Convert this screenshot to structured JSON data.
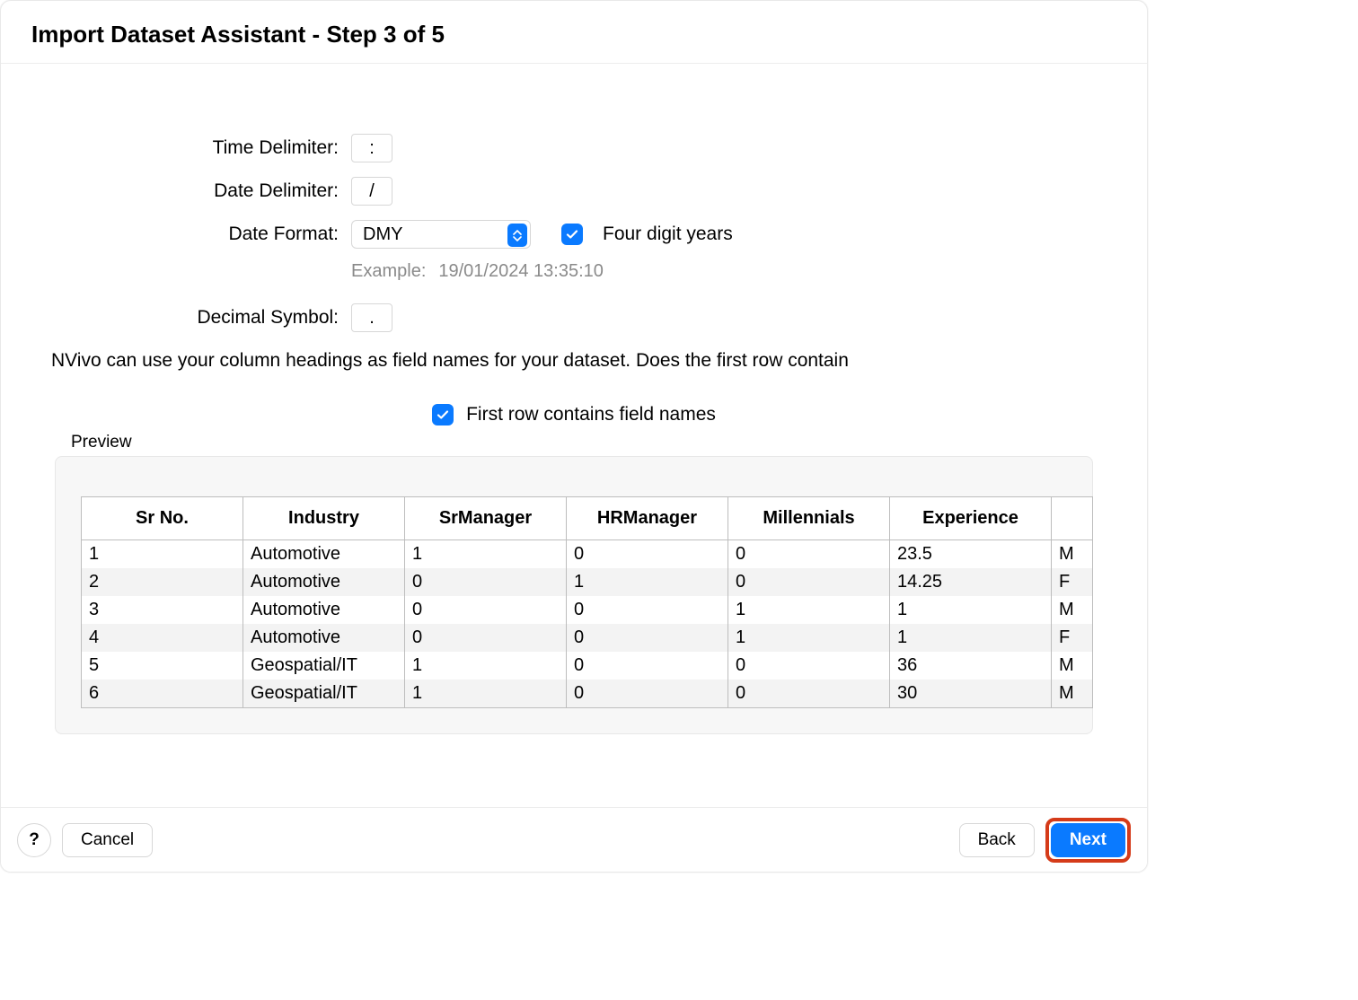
{
  "window": {
    "title": "Import Dataset Assistant - Step 3 of 5"
  },
  "form": {
    "time_delimiter_label": "Time Delimiter:",
    "time_delimiter_value": ":",
    "date_delimiter_label": "Date Delimiter:",
    "date_delimiter_value": "/",
    "date_format_label": "Date Format:",
    "date_format_value": "DMY",
    "four_digit_years_label": "Four digit years",
    "four_digit_years_checked": true,
    "example_label": "Example:",
    "example_value": "19/01/2024 13:35:10",
    "decimal_symbol_label": "Decimal Symbol:",
    "decimal_symbol_value": "."
  },
  "explain": "NVivo can use your column headings as field names for your dataset. Does the first row contain",
  "first_row": {
    "label": "First row contains field names",
    "checked": true
  },
  "preview": {
    "label": "Preview",
    "columns": [
      "Sr No.",
      "Industry",
      "SrManager",
      "HRManager",
      "Millennials",
      "Experience",
      ""
    ],
    "rows": [
      [
        "1",
        "Automotive",
        "1",
        "0",
        "0",
        "23.5",
        "M"
      ],
      [
        "2",
        "Automotive",
        "0",
        "1",
        "0",
        "14.25",
        "F"
      ],
      [
        "3",
        "Automotive",
        "0",
        "0",
        "1",
        "1",
        "M"
      ],
      [
        "4",
        "Automotive",
        "0",
        "0",
        "1",
        "1",
        "F"
      ],
      [
        "5",
        "Geospatial/IT",
        "1",
        "0",
        "0",
        "36",
        "M"
      ],
      [
        "6",
        "Geospatial/IT",
        "1",
        "0",
        "0",
        "30",
        "M"
      ]
    ]
  },
  "footer": {
    "help": "?",
    "cancel": "Cancel",
    "back": "Back",
    "next": "Next"
  }
}
